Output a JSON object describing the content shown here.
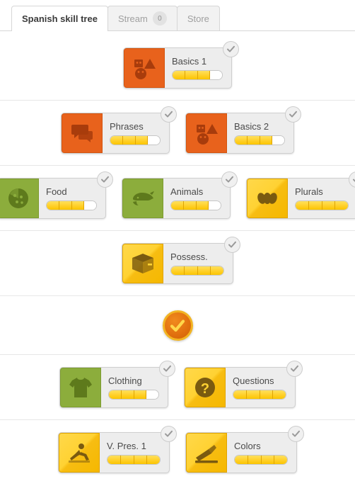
{
  "tabs": [
    {
      "label": "Spanish skill tree",
      "active": true,
      "badge": null
    },
    {
      "label": "Stream",
      "active": false,
      "badge": "0"
    },
    {
      "label": "Store",
      "active": false,
      "badge": null
    }
  ],
  "colors": {
    "orange_tile": "#E8621C",
    "green_tile": "#8CAD3C",
    "gold_tile": "#FFD233",
    "progress_fill": "#FFD02A",
    "card_body": "#EDEDED",
    "checkpoint_ring": "#F2B423",
    "checkpoint_body": "#E2710F"
  },
  "rows": [
    {
      "type": "skills",
      "skills": [
        {
          "name": "Basics 1",
          "tile": "orange",
          "icon": "shapes-faces-icon",
          "segments_total": 4,
          "segments_filled": 3,
          "completed": true
        }
      ]
    },
    {
      "type": "skills",
      "skills": [
        {
          "name": "Phrases",
          "tile": "orange",
          "icon": "speech-bubbles-icon",
          "segments_total": 4,
          "segments_filled": 3,
          "completed": true
        },
        {
          "name": "Basics 2",
          "tile": "orange",
          "icon": "shapes-faces-icon",
          "segments_total": 4,
          "segments_filled": 3,
          "completed": true
        }
      ]
    },
    {
      "type": "skills",
      "skills": [
        {
          "name": "Food",
          "tile": "green",
          "icon": "pizza-icon",
          "segments_total": 4,
          "segments_filled": 3,
          "completed": true
        },
        {
          "name": "Animals",
          "tile": "green",
          "icon": "whale-icon",
          "segments_total": 4,
          "segments_filled": 3,
          "completed": true
        },
        {
          "name": "Plurals",
          "tile": "gold",
          "icon": "beans-icon",
          "segments_total": 4,
          "segments_filled": 4,
          "completed": true
        }
      ]
    },
    {
      "type": "skills",
      "skills": [
        {
          "name": "Possess.",
          "tile": "gold",
          "icon": "box-icon",
          "segments_total": 4,
          "segments_filled": 4,
          "completed": true
        }
      ]
    },
    {
      "type": "checkpoint",
      "checkpoint": {
        "icon": "checkmark-icon",
        "completed": true
      }
    },
    {
      "type": "skills",
      "skills": [
        {
          "name": "Clothing",
          "tile": "green",
          "icon": "tshirt-icon",
          "segments_total": 4,
          "segments_filled": 3,
          "completed": true
        },
        {
          "name": "Questions",
          "tile": "gold",
          "icon": "question-mark-icon",
          "segments_total": 4,
          "segments_filled": 4,
          "completed": true
        }
      ]
    },
    {
      "type": "skills",
      "skills": [
        {
          "name": "V. Pres. 1",
          "tile": "gold",
          "icon": "running-person-icon",
          "segments_total": 4,
          "segments_filled": 4,
          "completed": true
        },
        {
          "name": "Colors",
          "tile": "gold",
          "icon": "paint-brush-icon",
          "segments_total": 4,
          "segments_filled": 4,
          "completed": true
        }
      ]
    }
  ]
}
